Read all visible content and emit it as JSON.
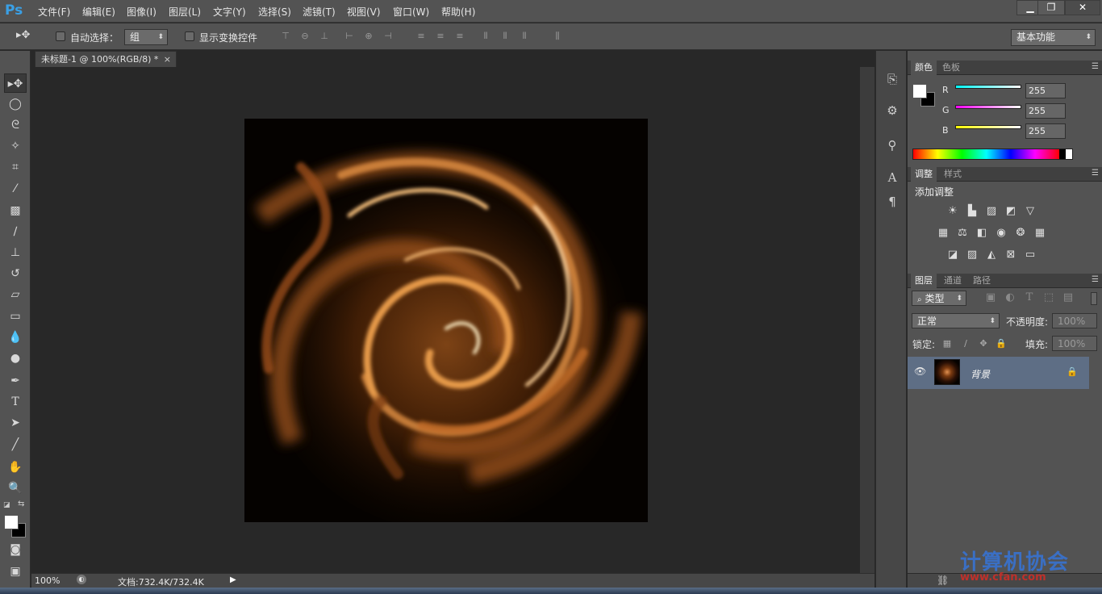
{
  "app": {
    "logo": "Ps"
  },
  "menu": [
    "文件(F)",
    "编辑(E)",
    "图像(I)",
    "图层(L)",
    "文字(Y)",
    "选择(S)",
    "滤镜(T)",
    "视图(V)",
    "窗口(W)",
    "帮助(H)"
  ],
  "window_controls": {
    "minimize": "▁",
    "restore": "❐",
    "close": "✕"
  },
  "options": {
    "auto_select_label": "自动选择：",
    "auto_select_value": "组",
    "show_transform_label": "显示变换控件",
    "workspace": "基本功能"
  },
  "document": {
    "tab_title": "未标题-1 @ 100%(RGB/8) *",
    "tab_close": "×",
    "zoom": "100%",
    "doc_size": "文档:732.4K/732.4K"
  },
  "color_panel": {
    "tabs": [
      "颜色",
      "色板"
    ],
    "channels": [
      {
        "label": "R",
        "value": "255",
        "color": "#00ffff"
      },
      {
        "label": "G",
        "value": "255",
        "color": "#ff00ff"
      },
      {
        "label": "B",
        "value": "255",
        "color": "#ffff00"
      }
    ]
  },
  "adjust_panel": {
    "tabs": [
      "调整",
      "样式"
    ],
    "title": "添加调整",
    "icons_row1": [
      "brightness-icon",
      "levels-icon",
      "curves-icon",
      "exposure-icon",
      "vibrance-icon"
    ],
    "icons_row2": [
      "hue-icon",
      "balance-icon",
      "bw-icon",
      "photo-filter-icon",
      "mixer-icon",
      "lookup-icon"
    ],
    "icons_row3": [
      "invert-icon",
      "posterize-icon",
      "threshold-icon",
      "selective-color-icon",
      "gradient-map-icon"
    ]
  },
  "layers_panel": {
    "tabs": [
      "图层",
      "通道",
      "路径"
    ],
    "filter_kind": "类型",
    "blend_mode": "正常",
    "opacity_label": "不透明度:",
    "opacity_value": "100%",
    "lock_label": "锁定:",
    "fill_label": "填充:",
    "fill_value": "100%",
    "layers": [
      {
        "name": "背景",
        "visible": true,
        "locked": true
      }
    ]
  },
  "watermark": {
    "text": "计算机协会",
    "url": "www.cfan.com"
  }
}
